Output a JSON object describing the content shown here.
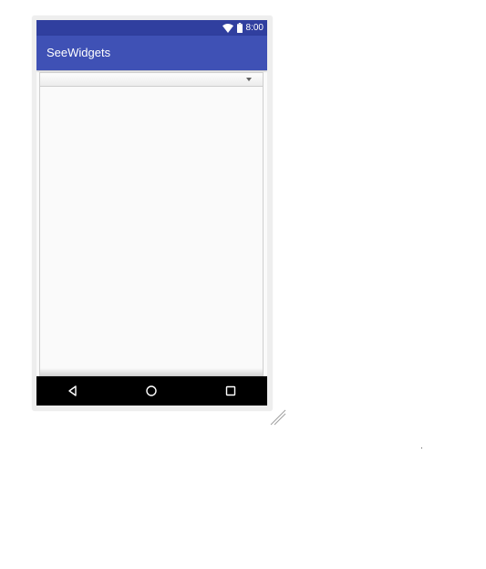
{
  "status_bar": {
    "time": "8:00",
    "wifi_icon": "wifi-icon",
    "battery_icon": "battery-icon"
  },
  "app_bar": {
    "title": "SeeWidgets"
  },
  "spinner": {
    "selected_value": "",
    "arrow_icon": "dropdown-arrow-icon"
  },
  "list": {
    "items": []
  },
  "nav_bar": {
    "back_icon": "back-triangle-icon",
    "home_icon": "home-circle-icon",
    "recents_icon": "recents-square-icon"
  },
  "colors": {
    "status_bar": "#303f9f",
    "app_bar": "#3f51b5",
    "nav_bar": "#000000",
    "screen_bg": "#fafafa",
    "frame": "#eeeeee"
  }
}
